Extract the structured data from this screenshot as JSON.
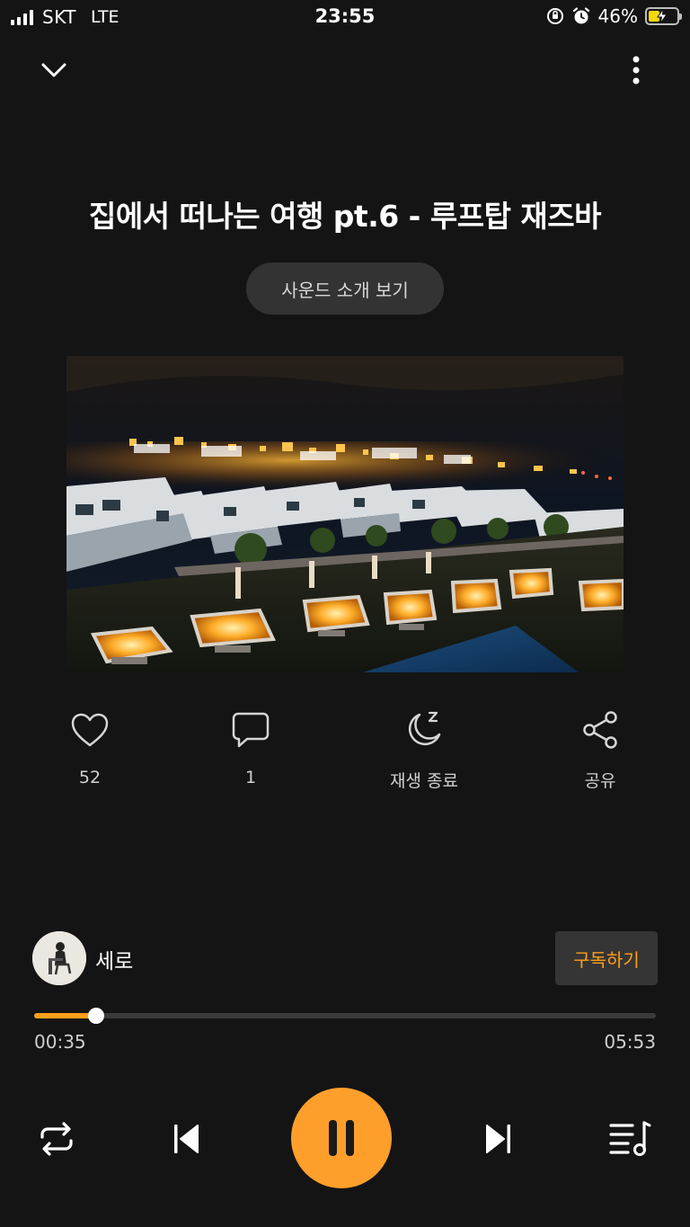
{
  "status_bar": {
    "carrier": "SKT",
    "network": "LTE",
    "time": "23:55",
    "battery_percent": "46%",
    "battery_level": 0.46,
    "icons": [
      "signal-icon",
      "orientation-lock-icon",
      "alarm-icon",
      "battery-charging-icon"
    ]
  },
  "header": {
    "collapse_icon": "chevron-down-icon",
    "more_icon": "more-vertical-icon"
  },
  "track": {
    "title": "집에서 떠나는 여행 pt.6 - 루프탑 재즈바",
    "intro_button": "사운드 소개 보기",
    "artwork": "night-rooftop-city-lights-image"
  },
  "actions": [
    {
      "icon": "heart-icon",
      "label": "52"
    },
    {
      "icon": "comment-icon",
      "label": "1"
    },
    {
      "icon": "sleep-timer-icon",
      "label": "재생 종료"
    },
    {
      "icon": "share-icon",
      "label": "공유"
    }
  ],
  "artist": {
    "name": "세로",
    "subscribe_label": "구독하기"
  },
  "player": {
    "current_time": "00:35",
    "total_time": "05:53",
    "progress": 0.0992,
    "controls": [
      "repeat-icon",
      "previous-icon",
      "pause-icon",
      "next-icon",
      "playlist-icon"
    ]
  },
  "colors": {
    "background": "#141414",
    "accent": "#ff9f1a",
    "button_dark": "#333333"
  }
}
